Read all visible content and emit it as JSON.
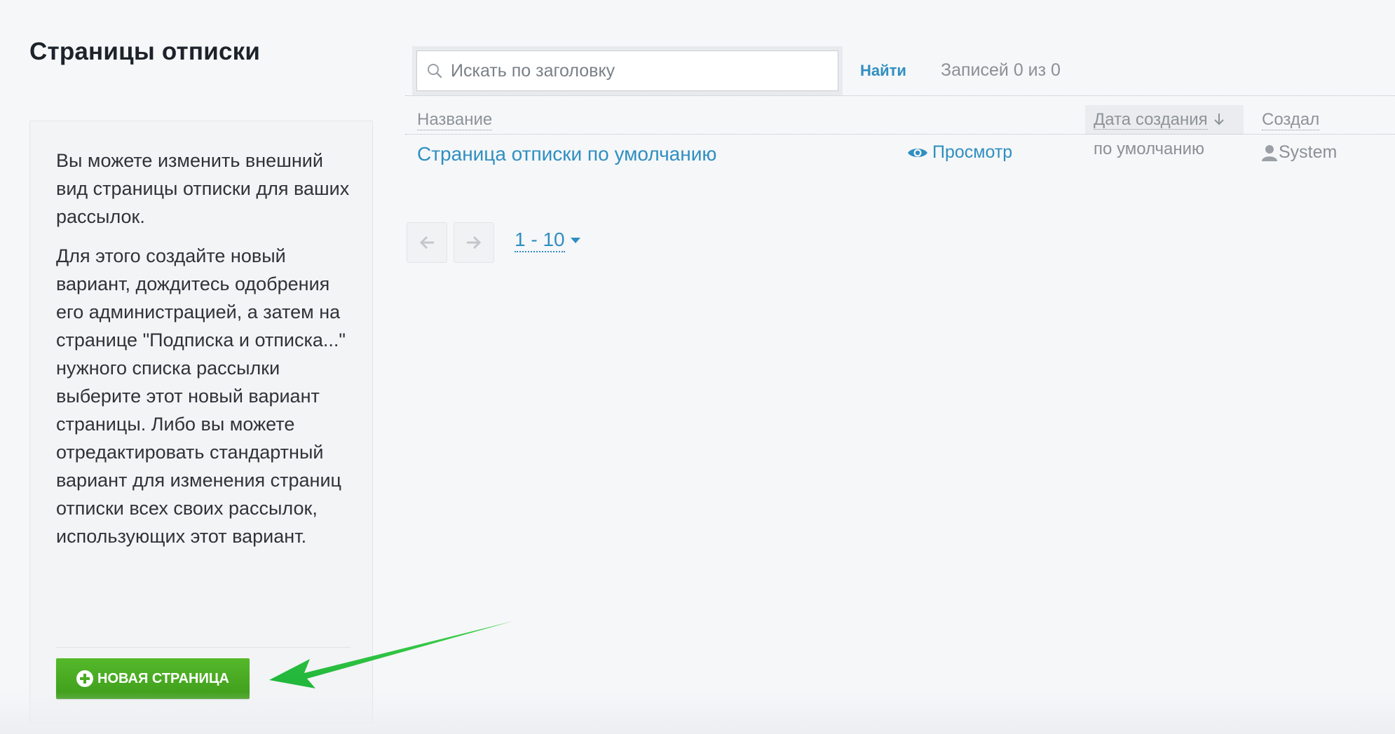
{
  "page": {
    "title": "Страницы отписки"
  },
  "info": {
    "paragraph1": "Вы можете изменить внешний вид страницы отписки для ваших рассылок.",
    "paragraph2": "Для этого создайте новый вариант, дождитесь одобрения его администрацией, а затем на странице \"Подписка и отписка...\" нужного списка рассылки выберите этот новый вариант страницы. Либо вы можете отредактировать стандартный вариант для изменения страниц отписки всех своих рассылок, использующих этот вариант.",
    "new_page_button": "НОВАЯ СТРАНИЦА"
  },
  "search": {
    "placeholder": "Искать по заголовку",
    "value": "",
    "find_label": "Найти",
    "records_count": "Записей 0 из 0"
  },
  "table": {
    "columns": {
      "name": "Название",
      "created_date": "Дата создания",
      "created_by": "Создал"
    },
    "rows": [
      {
        "title": "Страница отписки по умолчанию",
        "view_label": "Просмотр",
        "created_date": "по умолчанию",
        "created_by": "System"
      }
    ]
  },
  "pagination": {
    "page_size": "1 - 10"
  },
  "colors": {
    "accent": "#2f8fc1",
    "button_green": "#4aab22",
    "annotation_green": "#2ec23a",
    "muted_text": "#8a9096"
  },
  "icons": {
    "search": "search-icon",
    "view": "eye-icon",
    "user": "user-icon",
    "plus": "plus-circle-icon",
    "prev": "arrow-left-icon",
    "next": "arrow-right-icon",
    "sort": "arrow-down-icon",
    "caret": "caret-down-icon"
  }
}
